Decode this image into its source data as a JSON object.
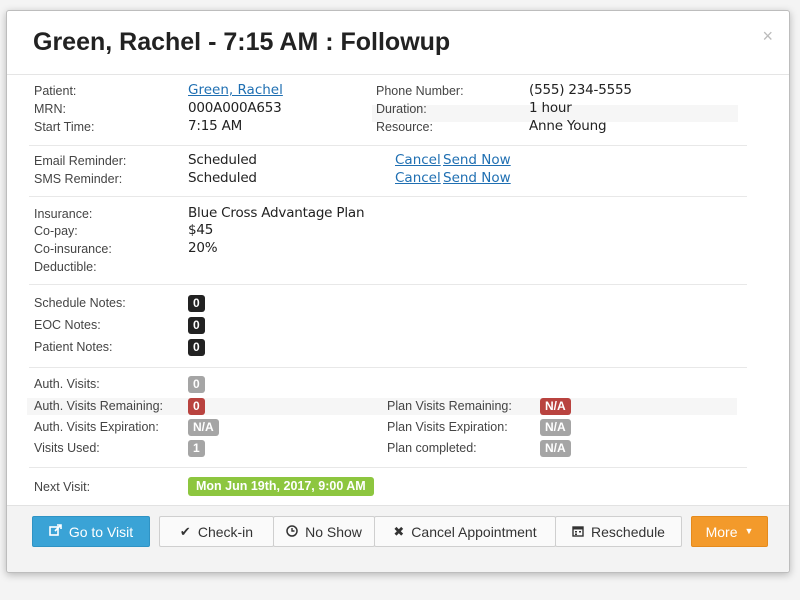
{
  "modal": {
    "title": "Green, Rachel - 7:15 AM : Followup",
    "close_label": "×"
  },
  "patient": {
    "patient_label": "Patient:",
    "patient_value": "Green, Rachel",
    "mrn_label": "MRN:",
    "mrn_value": "000A000A653",
    "start_time_label": "Start Time:",
    "start_time_value": "7:15 AM",
    "phone_label": "Phone Number:",
    "phone_value": "(555) 234-5555",
    "duration_label": "Duration:",
    "duration_value": "1 hour",
    "resource_label": "Resource:",
    "resource_value": "Anne Young"
  },
  "reminders": {
    "email_label": "Email Reminder:",
    "email_status": "Scheduled",
    "sms_label": "SMS Reminder:",
    "sms_status": "Scheduled",
    "cancel_link": "Cancel",
    "send_now_link": "Send Now"
  },
  "insurance": {
    "insurance_label": "Insurance:",
    "insurance_value": "Blue Cross Advantage Plan",
    "copay_label": "Co-pay:",
    "copay_value": "$45",
    "coins_label": "Co-insurance:",
    "coins_value": "20%",
    "deductible_label": "Deductible:",
    "deductible_value": ""
  },
  "notes": {
    "schedule_label": "Schedule Notes:",
    "schedule_count": "0",
    "eoc_label": "EOC Notes:",
    "eoc_count": "0",
    "patient_label": "Patient Notes:",
    "patient_count": "0"
  },
  "visits": {
    "auth_visits_label": "Auth. Visits:",
    "auth_visits_value": "0",
    "auth_remaining_label": "Auth. Visits Remaining:",
    "auth_remaining_value": "0",
    "auth_expiration_label": "Auth. Visits Expiration:",
    "auth_expiration_value": "N/A",
    "visits_used_label": "Visits Used:",
    "visits_used_value": "1",
    "plan_remaining_label": "Plan Visits Remaining:",
    "plan_remaining_value": "N/A",
    "plan_expiration_label": "Plan Visits Expiration:",
    "plan_expiration_value": "N/A",
    "plan_completed_label": "Plan completed:",
    "plan_completed_value": "N/A"
  },
  "next_visit": {
    "label": "Next Visit:",
    "value": "Mon Jun 19th, 2017, 9:00 AM"
  },
  "footer": {
    "go_to_visit": "Go to Visit",
    "check_in": "Check-in",
    "no_show": "No Show",
    "cancel_appointment": "Cancel Appointment",
    "reschedule": "Reschedule",
    "more": "More"
  },
  "colors": {
    "primary_button": "#3aa3d6",
    "more_button": "#f39a2b",
    "link": "#1f6fb2",
    "badge_dark": "#222222",
    "badge_gray": "#a5a5a5",
    "badge_red": "#b9433f",
    "badge_green": "#8dc63f"
  }
}
